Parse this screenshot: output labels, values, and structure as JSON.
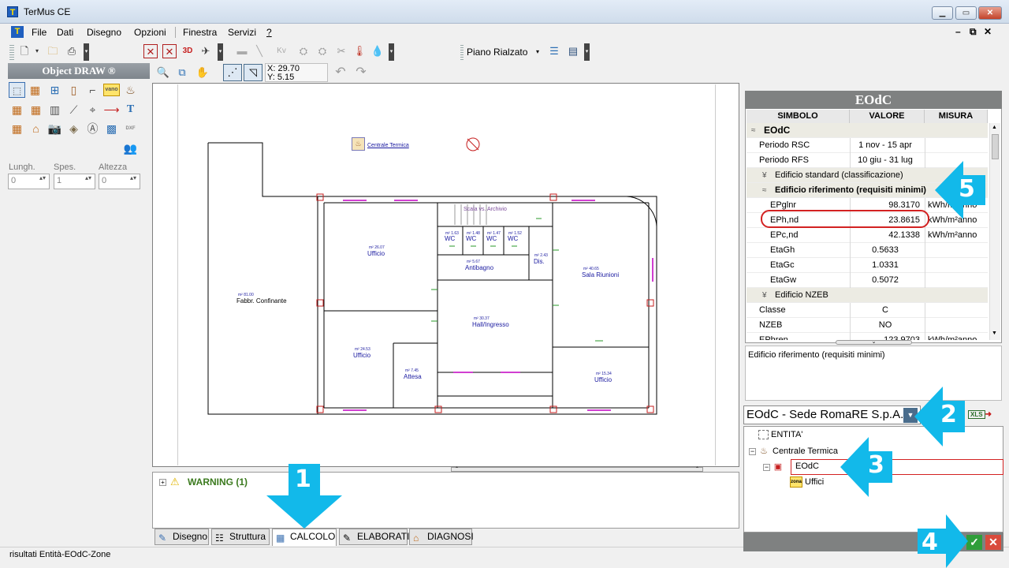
{
  "window": {
    "title": "TerMus CE"
  },
  "menu": [
    "File",
    "Dati",
    "Disegno",
    "Opzioni",
    "Finestra",
    "Servizi",
    "?"
  ],
  "toolbar": {
    "floor_select": "Piano Rialzato",
    "coord_x": "X: 29.70",
    "coord_y": "Y: 5.15",
    "label_3d": "3D",
    "label_kv": "Kv"
  },
  "palette": {
    "title": "Object DRAW ®",
    "badge_vano": "vano",
    "badge_dxf": "DXF",
    "fields": [
      {
        "label": "Lungh.",
        "value": "0"
      },
      {
        "label": "Spes.",
        "value": "1"
      },
      {
        "label": "Altezza",
        "value": "0"
      }
    ]
  },
  "drawing": {
    "thermal_label": "Centrale Termica",
    "stair_label": "Scala vs. Archivio",
    "rooms": [
      {
        "name": "Ufficio",
        "area": "m² 26.07"
      },
      {
        "name": "Fabbr. Confinante",
        "area": "m² 81.00"
      },
      {
        "name": "Antibagno",
        "area": "m² 5.67"
      },
      {
        "name": "Dis.",
        "area": "m² 2.43"
      },
      {
        "name": "Sala Riunioni",
        "area": "m² 40.65"
      },
      {
        "name": "Hall/Ingresso",
        "area": "m² 30.37"
      },
      {
        "name": "Ufficio",
        "area": "m² 24.53"
      },
      {
        "name": "Attesa",
        "area": "m² 7.45"
      },
      {
        "name": "Ufficio",
        "area": "m² 15.34"
      }
    ],
    "wc": [
      {
        "name": "WC",
        "area": "m² 1.63"
      },
      {
        "name": "WC",
        "area": "m² 1.48"
      },
      {
        "name": "WC",
        "area": "m² 1.47"
      },
      {
        "name": "WC",
        "area": "m² 1.52"
      }
    ]
  },
  "warning": {
    "text": "WARNING (1)"
  },
  "tabs": [
    "Disegno",
    "Struttura",
    "CALCOLO",
    "ELABORATI",
    "DIAGNOSI"
  ],
  "status": "risultati Entità-EOdC-Zone",
  "properties": {
    "title": "EOdC",
    "columns": [
      "SIMBOLO",
      "VALORE",
      "MISURA"
    ],
    "rows": [
      {
        "kind": "group",
        "level": 0,
        "label": "EOdC",
        "expander": "≈",
        "bold": true
      },
      {
        "symbol": "Periodo RSC",
        "value": "1 nov - 15 apr",
        "unit": "",
        "level": 0
      },
      {
        "symbol": "Periodo RFS",
        "value": "10 giu - 31 lug",
        "unit": "",
        "level": 0
      },
      {
        "kind": "group",
        "level": 1,
        "label": "Edificio standard (classificazione)",
        "expander": "¥",
        "bold": false
      },
      {
        "kind": "group",
        "level": 1,
        "label": "Edificio riferimento (requisiti minimi)",
        "expander": "≈",
        "bold": true
      },
      {
        "symbol": "EPglnr",
        "value": "98.3170",
        "unit": "kWh/m²anno",
        "level": 1
      },
      {
        "symbol": "EPh,nd",
        "value": "23.8615",
        "unit": "kWh/m²anno",
        "level": 1
      },
      {
        "symbol": "EPc,nd",
        "value": "42.1338",
        "unit": "kWh/m²anno",
        "level": 1
      },
      {
        "symbol": "EtaGh",
        "value": "0.5633",
        "unit": "",
        "level": 1
      },
      {
        "symbol": "EtaGc",
        "value": "1.0331",
        "unit": "",
        "level": 1
      },
      {
        "symbol": "EtaGw",
        "value": "0.5072",
        "unit": "",
        "level": 1
      },
      {
        "kind": "group",
        "level": 1,
        "label": "Edificio NZEB",
        "expander": "¥",
        "bold": false
      },
      {
        "symbol": "Classe",
        "value": "C",
        "unit": "",
        "level": 0
      },
      {
        "symbol": "NZEB",
        "value": "NO",
        "unit": "",
        "level": 0
      },
      {
        "symbol": "EPhren",
        "value": "123.9703",
        "unit": "kWh/m²anno",
        "level": 0
      }
    ],
    "description": "Edificio riferimento (requisiti minimi)"
  },
  "entity_combo": {
    "value": "EOdC - Sede RomaRE S.p.A."
  },
  "xls_label": "XLS",
  "zone_badge": "zona",
  "tree": [
    {
      "label": "ENTITA'",
      "level": 0,
      "icon": "dashed-box-icon"
    },
    {
      "label": "Centrale Termica",
      "level": 0,
      "icon": "boiler-icon"
    },
    {
      "label": "EOdC",
      "level": 1,
      "icon": "building-icon",
      "selected": true
    },
    {
      "label": "Uffici",
      "level": 2,
      "icon": "zone-icon"
    }
  ],
  "callouts": [
    "1",
    "2",
    "3",
    "4",
    "5"
  ],
  "colors": {
    "accent_callout": "#12b9ea",
    "highlight_red": "#d32222",
    "panel_header": "#7f8181"
  }
}
